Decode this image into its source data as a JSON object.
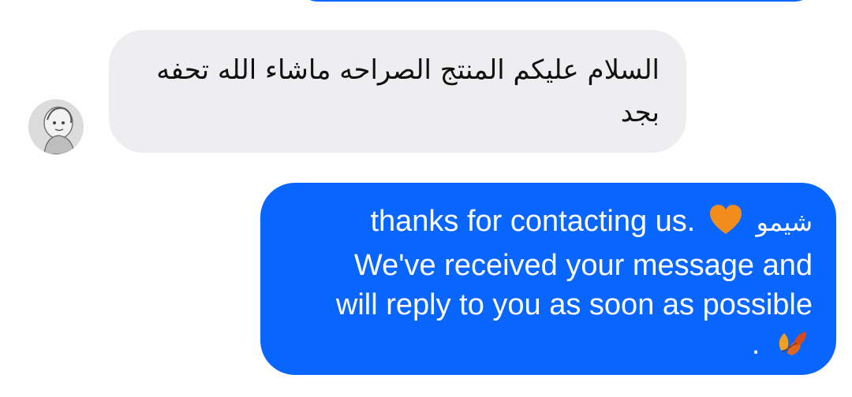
{
  "conversation": {
    "incoming": {
      "text": "السلام عليكم المنتج الصراحه ماشاء الله تحفه بجد",
      "avatar_icon": "user-avatar-photo"
    },
    "outgoing": {
      "name": "شيمو",
      "heart_icon": "orange-heart-icon",
      "line1_text": "thanks for contacting us.",
      "line2_text": "We've received your message and",
      "line3_text": "will reply to you as soon as possible",
      "leaves_icon": "autumn-leaves-icon",
      "line4_text": "."
    },
    "colors": {
      "outgoing_bubble": "#0866ff",
      "incoming_bubble": "#eeeef0",
      "outgoing_text": "#ffffff",
      "incoming_text": "#111111"
    }
  }
}
